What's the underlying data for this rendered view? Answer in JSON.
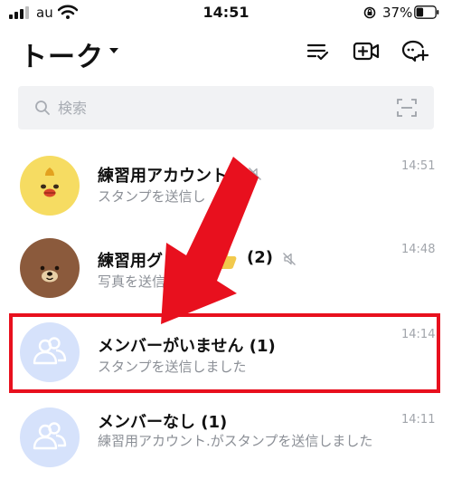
{
  "status_bar": {
    "carrier": "au",
    "time": "14:51",
    "battery": "37%"
  },
  "header": {
    "title": "トーク"
  },
  "search": {
    "placeholder": "検索"
  },
  "chats": [
    {
      "name": "練習用アカウント",
      "message": "スタンプを送信し",
      "time": "14:51",
      "avatar": "chick-avatar"
    },
    {
      "name": "練習用グ",
      "member_count": "(2)",
      "message": "写真を送信",
      "time": "14:48",
      "avatar": "bear-avatar"
    },
    {
      "name": "メンバーがいません (1)",
      "message": "スタンプを送信しました",
      "time": "14:14",
      "avatar": "group-placeholder-avatar"
    },
    {
      "name": "メンバーなし (1)",
      "message": "練習用アカウント.がスタンプを送信しました",
      "time": "14:11",
      "avatar": "group-placeholder-avatar"
    }
  ],
  "colors": {
    "highlight": "#e8101e",
    "placeholder_avatar": "#d6e2fb",
    "chick_yellow": "#f6dc62",
    "bear_brown": "#8b5a3c"
  }
}
